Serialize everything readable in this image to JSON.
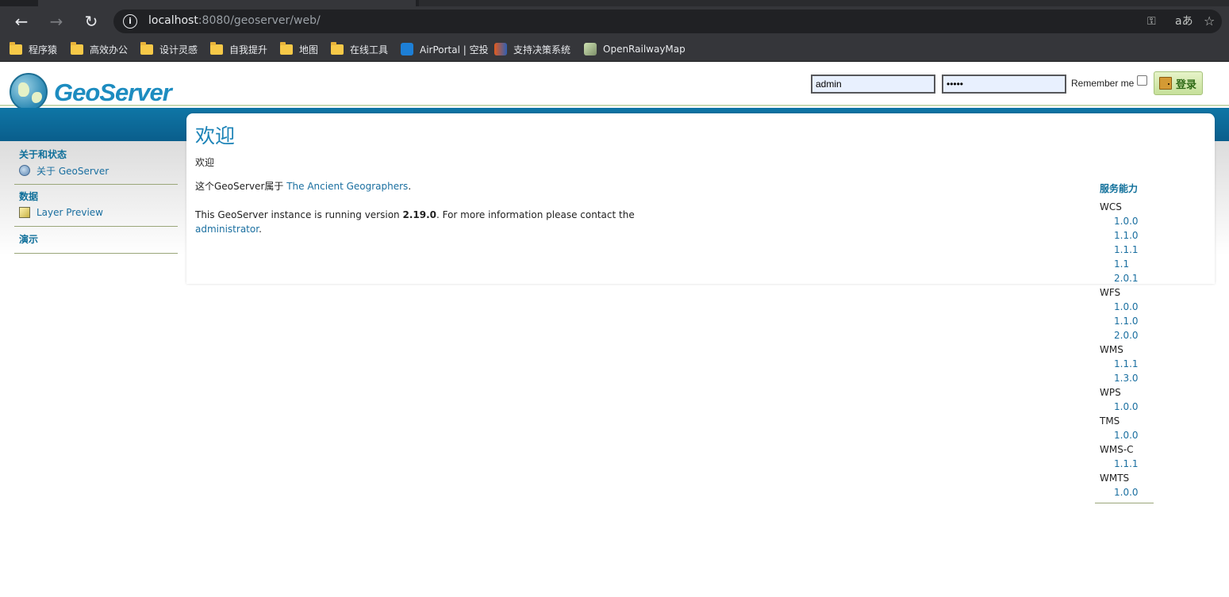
{
  "browser": {
    "url_host": "localhost",
    "url_rest": ":8080/geoserver/web/",
    "bookmarks": [
      "程序猿",
      "高效办公",
      "设计灵感",
      "自我提升",
      "地图",
      "在线工具",
      "AirPortal | 空投",
      "支持决策系统",
      "OpenRailwayMap"
    ]
  },
  "header": {
    "logo_text": "GeoServer",
    "username_value": "admin",
    "password_value": "•••••",
    "remember_label": "Remember me",
    "login_label": "登录"
  },
  "sidebar": {
    "section1_title": "关于和状态",
    "about_label": "关于 GeoServer",
    "section2_title": "数据",
    "layer_preview_label": "Layer Preview",
    "section3_title": "演示"
  },
  "main": {
    "title": "欢迎",
    "subtitle": "欢迎",
    "belongs_prefix": "这个GeoServer属于 ",
    "belongs_link": "The Ancient Geographers",
    "period": ".",
    "version_prefix": "This GeoServer instance is running version ",
    "version": "2.19.0",
    "version_suffix": ". For more information please contact the",
    "admin_link": "administrator"
  },
  "capabilities": {
    "title": "服务能力",
    "services": [
      {
        "name": "WCS",
        "versions": [
          "1.0.0",
          "1.1.0",
          "1.1.1",
          "1.1",
          "2.0.1"
        ]
      },
      {
        "name": "WFS",
        "versions": [
          "1.0.0",
          "1.1.0",
          "2.0.0"
        ]
      },
      {
        "name": "WMS",
        "versions": [
          "1.1.1",
          "1.3.0"
        ]
      },
      {
        "name": "WPS",
        "versions": [
          "1.0.0"
        ]
      },
      {
        "name": "TMS",
        "versions": [
          "1.0.0"
        ]
      },
      {
        "name": "WMS-C",
        "versions": [
          "1.1.1"
        ]
      },
      {
        "name": "WMTS",
        "versions": [
          "1.0.0"
        ]
      }
    ]
  }
}
